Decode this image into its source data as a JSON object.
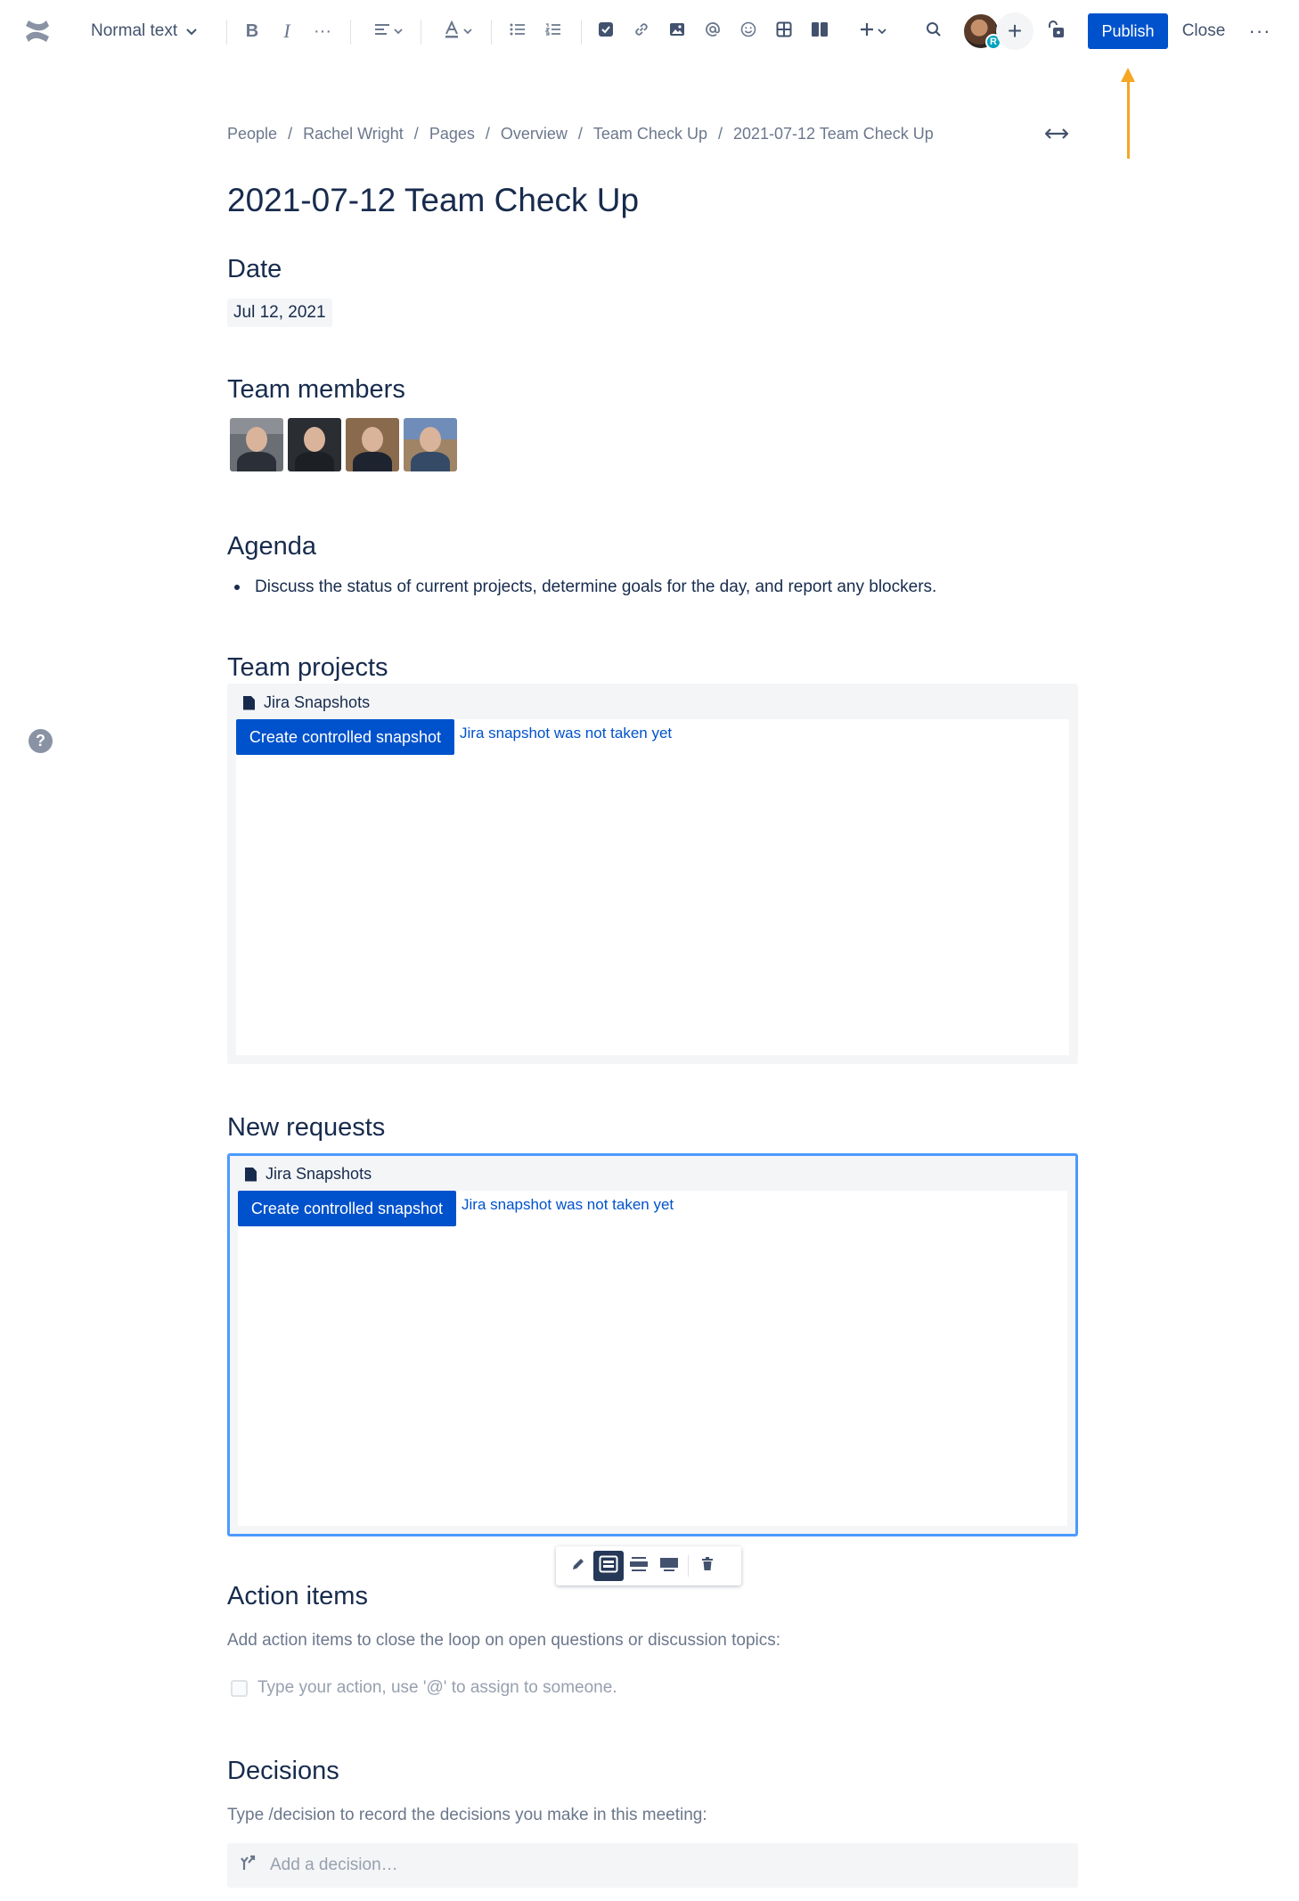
{
  "toolbar": {
    "text_style": "Normal text",
    "bold": "B",
    "italic": "I",
    "more_formatting": "···",
    "publish_label": "Publish",
    "close_label": "Close",
    "more_label": "···",
    "avatar_badge": "R",
    "icons": [
      "confluence-logo-icon",
      "chevron-down-icon",
      "bold-icon",
      "italic-icon",
      "more-formatting-icon",
      "align-icon",
      "text-color-icon",
      "bullet-list-icon",
      "numbered-list-icon",
      "task-icon",
      "link-icon",
      "image-icon",
      "mention-icon",
      "emoji-icon",
      "table-icon",
      "layouts-icon",
      "insert-plus-icon",
      "search-icon",
      "restrictions-icon"
    ]
  },
  "breadcrumb": [
    "People",
    "Rachel Wright",
    "Pages",
    "Overview",
    "Team Check Up",
    "2021-07-12 Team Check Up"
  ],
  "page": {
    "title": "2021-07-12 Team Check Up",
    "date_heading": "Date",
    "date_value": "Jul 12, 2021",
    "members_heading": "Team members",
    "agenda_heading": "Agenda",
    "agenda_items": [
      "Discuss the status of current projects, determine goals for the day, and report any blockers."
    ],
    "projects_heading": "Team projects",
    "requests_heading": "New requests",
    "action_heading": "Action items",
    "action_text": "Add action items to close the loop on open questions or discussion topics:",
    "task_placeholder": "Type your action, use '@' to assign to someone.",
    "decisions_heading": "Decisions",
    "decisions_text": "Type /decision to record the decisions you make in this meeting:",
    "decision_placeholder": "Add a decision…"
  },
  "macros": [
    {
      "title": "Jira Snapshots",
      "button": "Create controlled snapshot",
      "status": "Jira snapshot was not taken yet"
    },
    {
      "title": "Jira Snapshots",
      "button": "Create controlled snapshot",
      "status": "Jira snapshot was not taken yet"
    }
  ],
  "colors": {
    "primary": "#0052CC",
    "text": "#172B4D",
    "subtle": "#6B778C",
    "annotation_arrow": "#F5A623",
    "selection": "#4C9AFF"
  },
  "help_label": "?"
}
